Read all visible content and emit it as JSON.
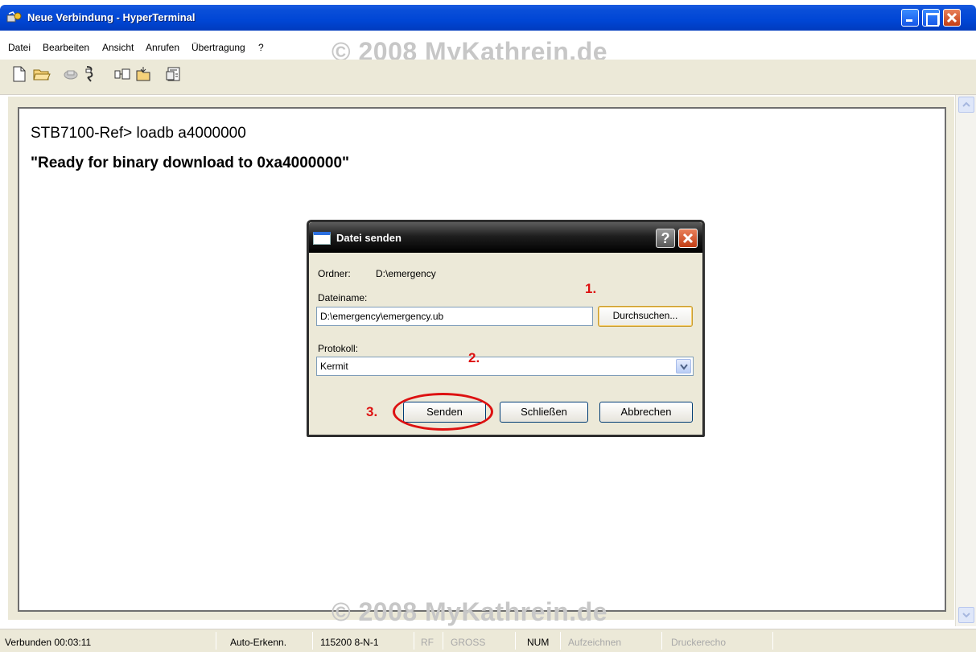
{
  "window": {
    "title": "Neue Verbindung - HyperTerminal"
  },
  "menu": {
    "items": [
      "Datei",
      "Bearbeiten",
      "Ansicht",
      "Anrufen",
      "Übertragung",
      "?"
    ]
  },
  "watermark": "© 2008 MyKathrein.de",
  "terminal": {
    "lines": [
      "STB7100-Ref> loadb a4000000",
      "\"Ready for binary download to 0xa4000000\""
    ]
  },
  "dialog": {
    "title": "Datei senden",
    "help_label": "?",
    "ordner_label": "Ordner:",
    "ordner_value": "D:\\emergency",
    "dateiname_label": "Dateiname:",
    "dateiname_value": "D:\\emergency\\emergency.ub",
    "durchsuchen_label": "Durchsuchen...",
    "protokoll_label": "Protokoll:",
    "protokoll_value": "Kermit",
    "senden_label": "Senden",
    "schliessen_label": "Schließen",
    "abbrechen_label": "Abbrechen",
    "annotations": [
      "1.",
      "2.",
      "3."
    ]
  },
  "status": {
    "connected": "Verbunden 00:03:11",
    "detect": "Auto-Erkenn.",
    "baud": "115200 8-N-1",
    "rf": "RF",
    "gross": "GROSS",
    "num": "NUM",
    "record": "Aufzeichnen",
    "echo": "Druckerecho"
  },
  "colors": {
    "titlebar": "#0046d5",
    "annotation": "#dd1111",
    "watermark": "#c7c7c7"
  }
}
